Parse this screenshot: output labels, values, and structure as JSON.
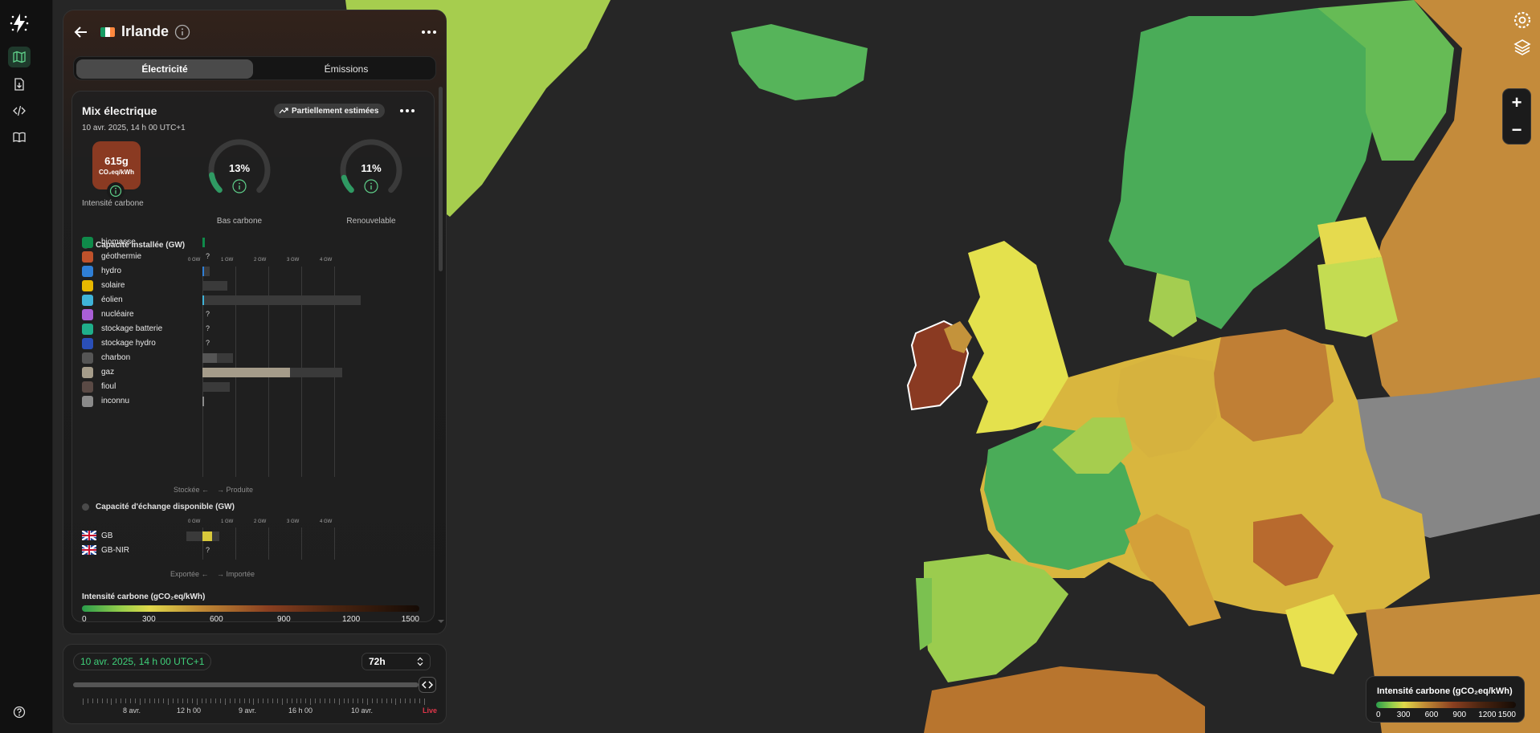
{
  "rail": {
    "items": [
      "logo-icon",
      "map-icon",
      "download-icon",
      "code-icon",
      "book-icon",
      "help-icon"
    ]
  },
  "panel": {
    "country": "Irlande",
    "flag_colors": [
      "#169b62",
      "#ffffff",
      "#ff883e"
    ],
    "tabs": [
      "Électricité",
      "Émissions"
    ],
    "active_tab": "Électricité"
  },
  "mix": {
    "title": "Mix électrique",
    "date": "10 avr. 2025, 14 h 00 UTC+1",
    "estimated_label": "Partiellement estimées",
    "carbon_intensity": {
      "value": "615g",
      "unit": "CO₂eq/kWh",
      "label": "Intensité carbone",
      "color": "#8a3a22"
    },
    "low_carbon": {
      "value": "13%",
      "fraction": 0.13,
      "label": "Bas carbone"
    },
    "renewable": {
      "value": "11%",
      "fraction": 0.11,
      "label": "Renouvelable"
    },
    "capacity_title": "Capacité installée (GW)",
    "axis_ticks": [
      "0 GW",
      "1 GW",
      "2 GW",
      "3 GW",
      "4 GW"
    ],
    "sources": [
      {
        "name": "biomasse",
        "color": "#0f8a4a",
        "capacity_gw": 0.07,
        "production_gw": 0.07,
        "unknown": false
      },
      {
        "name": "géothermie",
        "color": "#c0522b",
        "capacity_gw": 0,
        "production_gw": 0,
        "unknown": true
      },
      {
        "name": "hydro",
        "color": "#2f7fd6",
        "capacity_gw": 0.22,
        "production_gw": 0.05,
        "unknown": false
      },
      {
        "name": "solaire",
        "color": "#e8b800",
        "capacity_gw": 0.75,
        "production_gw": 0,
        "unknown": true
      },
      {
        "name": "éolien",
        "color": "#3fb3d8",
        "capacity_gw": 4.8,
        "production_gw": 0.04,
        "unknown": false
      },
      {
        "name": "nucléaire",
        "color": "#a95fd6",
        "capacity_gw": 0,
        "production_gw": 0,
        "unknown": true
      },
      {
        "name": "stockage batterie",
        "color": "#1fae8a",
        "capacity_gw": 0,
        "production_gw": 0,
        "unknown": true
      },
      {
        "name": "stockage hydro",
        "color": "#2a4fb8",
        "capacity_gw": 0,
        "production_gw": 0,
        "unknown": true
      },
      {
        "name": "charbon",
        "color": "#555555",
        "capacity_gw": 0.92,
        "production_gw": 0.45,
        "unknown": false
      },
      {
        "name": "gaz",
        "color": "#a59c8a",
        "capacity_gw": 4.25,
        "production_gw": 2.65,
        "unknown": false
      },
      {
        "name": "fioul",
        "color": "#5a4a45",
        "capacity_gw": 0.84,
        "production_gw": 0,
        "unknown": false
      },
      {
        "name": "inconnu",
        "color": "#8a8a8a",
        "capacity_gw": 0,
        "production_gw": 0.02,
        "unknown": false
      }
    ],
    "stored_label": "Stockée",
    "produced_label": "Produite",
    "exchange_title": "Capacité d'échange disponible (GW)",
    "exchanges": [
      {
        "name": "GB",
        "import_gw": 0.3,
        "export_capacity_gw": -0.5,
        "import_capacity_gw": 0.5,
        "unknown": false
      },
      {
        "name": "GB-NIR",
        "import_gw": 0,
        "export_capacity_gw": 0,
        "import_capacity_gw": 0,
        "unknown": true
      }
    ],
    "exported_label": "Exportée",
    "imported_label": "Importée",
    "legend_title": "Intensité carbone (gCO₂eq/kWh)",
    "legend_ticks": [
      "0",
      "300",
      "600",
      "900",
      "1200",
      "1500"
    ]
  },
  "time": {
    "date": "10 avr. 2025, 14 h 00 UTC+1",
    "range": "72h",
    "tick_labels": [
      "8 avr.",
      "12 h 00",
      "9 avr.",
      "16 h 00",
      "10 avr."
    ],
    "live": "Live"
  },
  "map_legend": {
    "title": "Intensité carbone (gCO₂eq/kWh)",
    "ticks": [
      "0",
      "300",
      "600",
      "900",
      "1200",
      "1500"
    ]
  },
  "map_controls": {
    "zoom_in": "+",
    "zoom_out": "−"
  }
}
